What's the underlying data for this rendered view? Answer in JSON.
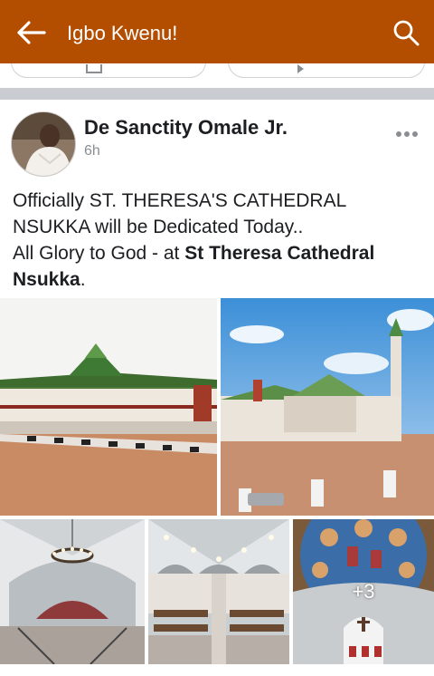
{
  "header": {
    "title": "Igbo Kwenu!",
    "back_icon": "back-arrow-icon",
    "search_icon": "search-icon",
    "bg_color": "#b34d00"
  },
  "post": {
    "author": "De Sanctity Omale Jr.",
    "time": "6h",
    "text_line1": "Officially  ST. THERESA'S CATHEDRAL NSUKKA will be Dedicated Today..",
    "text_line2_prefix": "All Glory to God - at ",
    "place": "St Theresa Cathedral Nsukka",
    "text_suffix": ".",
    "more_photos": "+3"
  }
}
